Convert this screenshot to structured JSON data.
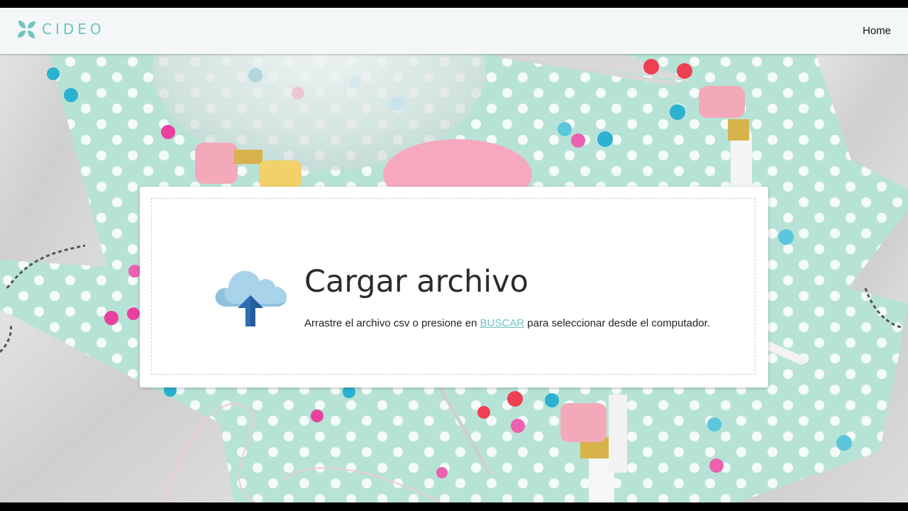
{
  "navbar": {
    "brand_name": "CIDEO",
    "brand_icon": "leaf-logo-icon",
    "home_label": "Home"
  },
  "upload": {
    "icon": "cloud-upload-icon",
    "title": "Cargar archivo",
    "description_before": "Arrastre el archivo csv o presione en ",
    "link_label": "BUSCAR",
    "description_after": " para seleccionar desde el computador."
  },
  "colors": {
    "brand": "#6fc3c0",
    "navbar_bg": "#f3f7f8",
    "background_mint": "#b7e3d6",
    "link": "#6fc3c0"
  }
}
